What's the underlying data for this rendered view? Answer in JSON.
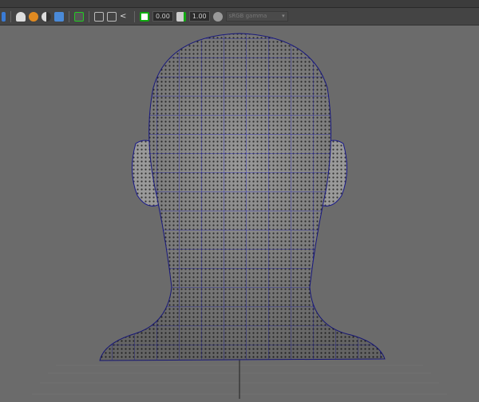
{
  "toolbar": {
    "exposure_value": "0.00",
    "gamma_value": "1.00",
    "color_space": "sRGB gamma",
    "icons": [
      "object-icon",
      "lights-icon",
      "material-icon",
      "shadow-icon",
      "texture-icon",
      "isolate-icon",
      "xray-icon",
      "wireframe-icon",
      "components-icon",
      "exposure-icon",
      "gamma-icon",
      "color-management-icon"
    ]
  },
  "colors": {
    "wire": "#2020c0",
    "viewport": "#6b6b6b",
    "mesh": "#8a8a8a"
  }
}
